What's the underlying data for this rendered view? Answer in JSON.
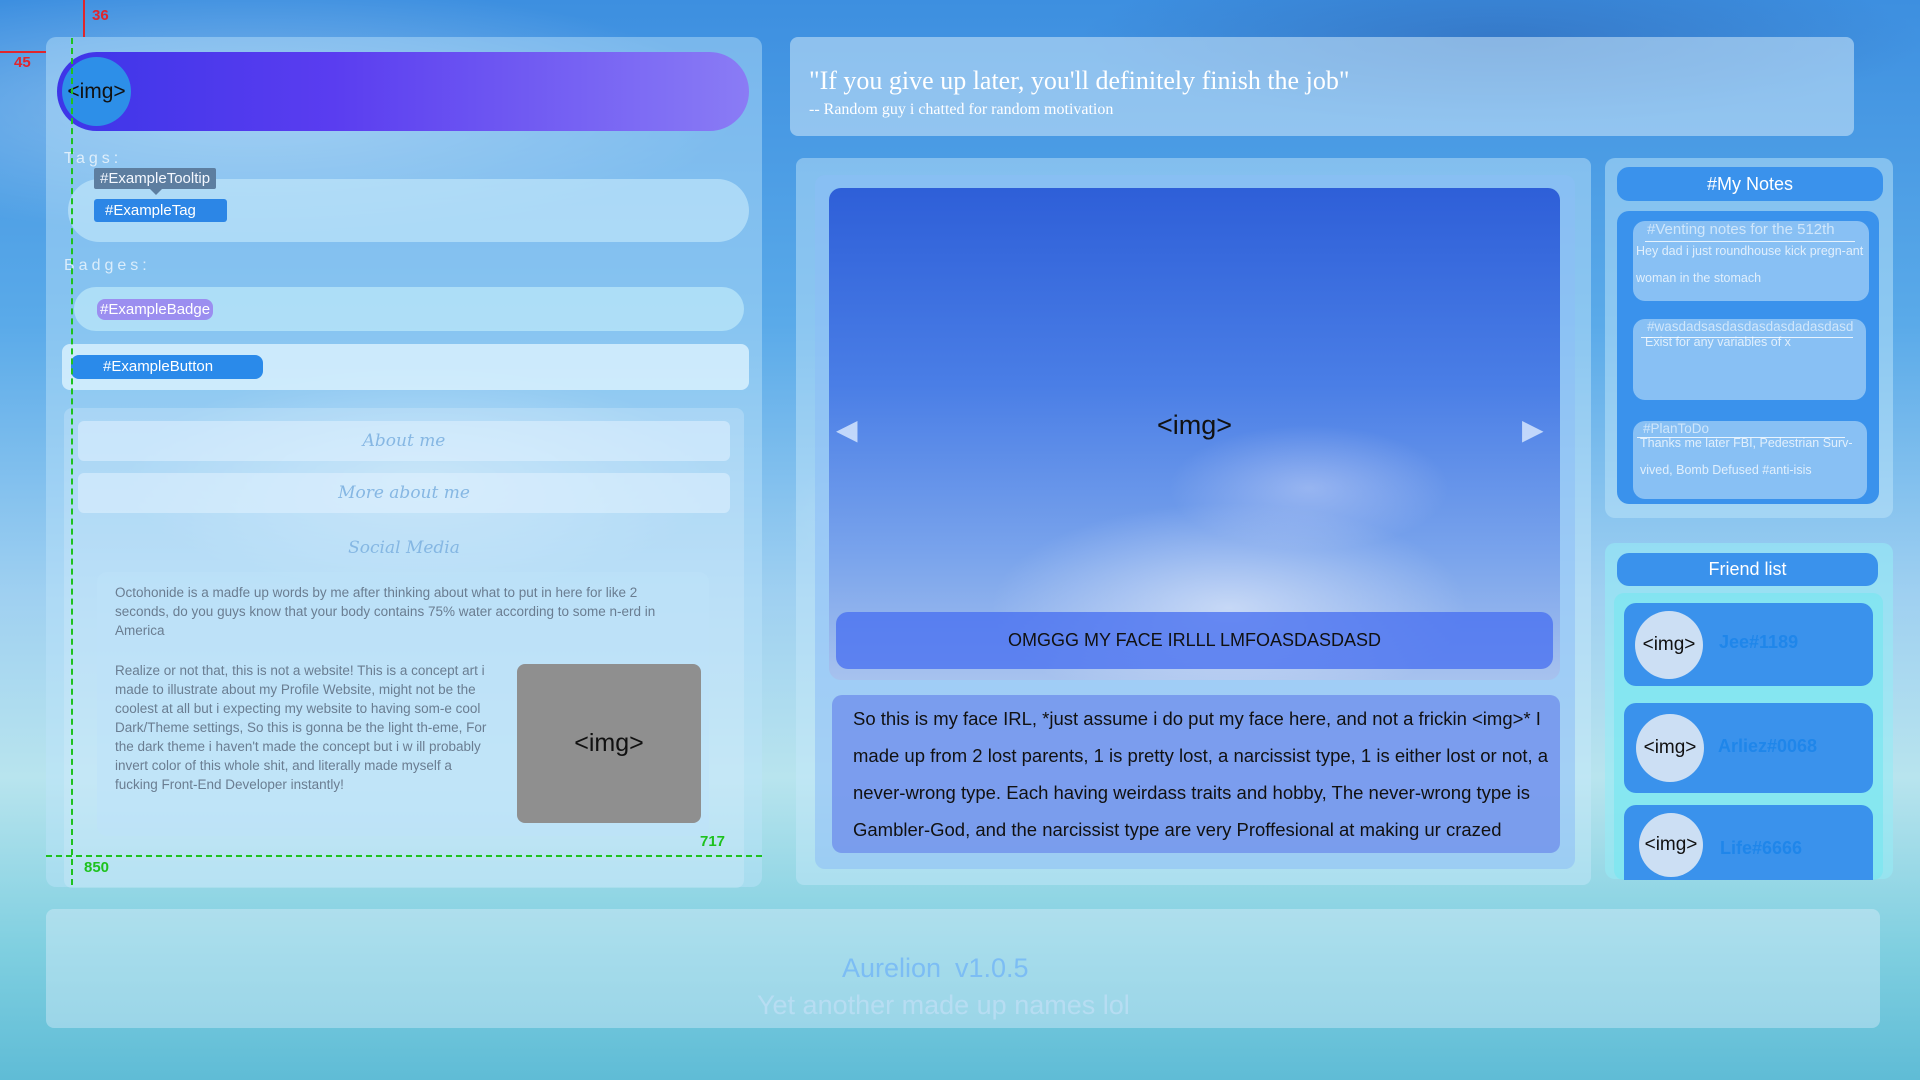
{
  "guides": {
    "top_offset": "36",
    "left_offset": "45",
    "width_mark": "717",
    "height_mark": "850"
  },
  "profile": {
    "avatar_placeholder": "<img>"
  },
  "tags": {
    "label": "Tags:",
    "tooltip": "#ExampleTooltip",
    "tag": "#ExampleTag"
  },
  "badges": {
    "label": "Badges:",
    "badge": "#ExampleBadge"
  },
  "button": {
    "label": "#ExampleButton"
  },
  "about": {
    "about_me": "About me",
    "more_about_me": "More about me",
    "social_media": "Social Media",
    "paragraph_1": "Octohonide is a madfe up words by me after thinking about what to put in here for like 2 seconds, do you guys know that your body contains 75% water according to some n-erd in America",
    "paragraph_2": "Realize or not that, this is not a website! This is a concept art i made to illustrate about my Profile Website, might not be the coolest at all but i expecting my website to having som-e cool Dark/Theme settings, So this is gonna be the light th-eme, For the dark theme i haven't made the concept but i w ill probably invert color of this whole shit, and literally made myself a fucking Front-End Developer instantly!",
    "image_placeholder": "<img>"
  },
  "quote": {
    "text": "\"If you give up later, you'll definitely finish the job\"",
    "author": "-- Random guy i chatted for random motivation"
  },
  "slider": {
    "image_placeholder": "<img>",
    "prev_arrow": "◀",
    "next_arrow": "▶",
    "caption": "OMGGG MY FACE IRLLL LMFOASDASDASD",
    "description": "So this is my face IRL, *just assume i do put my face here, and not a frickin <img>* I made up from 2 lost parents, 1 is pretty lost, a narcissist type, 1 is either lost or not, a never-wrong type. Each having weirdass traits and hobby, The never-wrong type is Gambler-God, and the narcissist type are very Proffesional at making ur crazed"
  },
  "notes": {
    "title": "#My Notes",
    "items": [
      {
        "title": "#Venting notes for the 512th",
        "body": "Hey dad i just roundhouse kick pregn-ant woman in the stomach"
      },
      {
        "title": "#wasdadsasdasdasdasdadasdasd",
        "body": "Exist for any variables of x"
      },
      {
        "title": "#PlanToDo",
        "body": "Thanks me later FBI, Pedestrian Surv-vived, Bomb Defused  #anti-isis"
      }
    ]
  },
  "friends": {
    "title": "Friend list",
    "items": [
      {
        "avatar": "<img>",
        "name": "Jee#1189"
      },
      {
        "avatar": "<img>",
        "name": "Arliez#0068"
      },
      {
        "avatar": "<img>",
        "name": "Life#6666"
      }
    ]
  },
  "footer": {
    "name": "Aurelion",
    "version": "v1.0.5",
    "tagline": "Yet another made up names lol"
  }
}
